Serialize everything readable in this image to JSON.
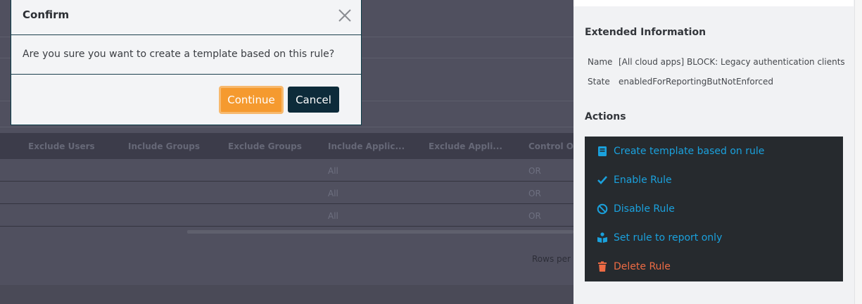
{
  "modal": {
    "title": "Confirm",
    "message": "Are you sure you want to create a template based on this rule?",
    "continue_label": "Continue",
    "cancel_label": "Cancel"
  },
  "table": {
    "headers": [
      "Exclude Users",
      "Include Groups",
      "Exclude Groups",
      "Include Applic...",
      "Exclude Appli...",
      "Control Op"
    ],
    "rows": [
      {
        "include_apps": "All",
        "control_op": "OR"
      },
      {
        "include_apps": "All",
        "control_op": "OR"
      },
      {
        "include_apps": "All",
        "control_op": "OR"
      }
    ],
    "rows_per_page_label": "Rows per"
  },
  "panel": {
    "extended_title": "Extended Information",
    "info": [
      {
        "key": "Name",
        "value": "[All cloud apps] BLOCK: Legacy authentication clients"
      },
      {
        "key": "State",
        "value": "enabledForReportingButNotEnforced"
      }
    ],
    "actions_title": "Actions",
    "actions": [
      {
        "label": "Create template based on rule",
        "icon": "book-icon"
      },
      {
        "label": "Enable Rule",
        "icon": "check-icon"
      },
      {
        "label": "Disable Rule",
        "icon": "ban-icon"
      },
      {
        "label": "Set rule to report only",
        "icon": "report-user-icon"
      },
      {
        "label": "Delete Rule",
        "icon": "trash-icon"
      }
    ]
  },
  "colors": {
    "accent_blue": "#1aa1dd",
    "danger": "#ee6b44",
    "continue": "#f59a2f",
    "cancel": "#0d2b3a"
  }
}
